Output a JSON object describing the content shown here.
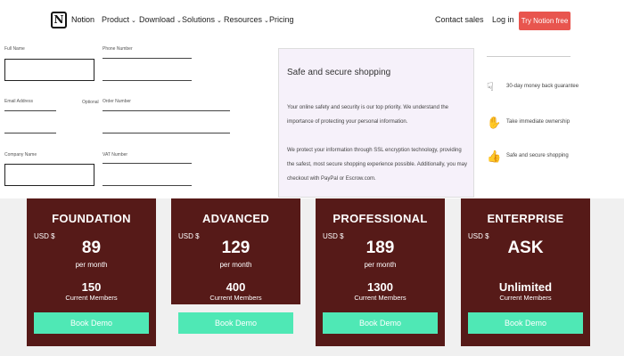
{
  "nav": {
    "logo_letter": "N",
    "brand": "Notion",
    "items": [
      {
        "label": "Product",
        "chevron": "⌄"
      },
      {
        "label": "Download",
        "chevron": "⌄"
      },
      {
        "label": "Solutions",
        "chevron": "⌄"
      },
      {
        "label": "Resources",
        "chevron": "⌄"
      },
      {
        "label": "Pricing",
        "chevron": ""
      }
    ],
    "contact_sales": "Contact sales",
    "login": "Log in",
    "cta": "Try Notion free",
    "cta_color": "#e8554e"
  },
  "form": {
    "full_name": "Full Name",
    "phone_number": "Phone Number",
    "email_address": "Email Address",
    "optional": "Optional",
    "order_number": "Order Number",
    "company_name": "Company Name",
    "vat_number": "VAT Number"
  },
  "secure": {
    "title": "Safe and secure shopping",
    "p1": "Your online safety and security is our top priority. We understand the importance of protecting your personal information.",
    "p2": "We protect your information through SSL encryption technology, providing the safest, most secure shopping experience possible. Additionally, you may checkout with PayPal or Escrow.com."
  },
  "features": [
    {
      "icon": "money-back-icon",
      "glyph": "☟",
      "label": "30-day money back guarantee"
    },
    {
      "icon": "ownership-icon",
      "glyph": "✋",
      "label": "Take immediate ownership"
    },
    {
      "icon": "thumbs-up-icon",
      "glyph": "👍",
      "label": "Safe and secure shopping"
    }
  ],
  "plans": [
    {
      "name": "FOUNDATION",
      "currency": "USD $",
      "price": "89",
      "period": "per month",
      "members": "150",
      "members_label": "Current Members",
      "button": "Book Demo"
    },
    {
      "name": "ADVANCED",
      "currency": "USD $",
      "price": "129",
      "period": "per month",
      "members": "400",
      "members_label": "Current Members",
      "button": "Book Demo"
    },
    {
      "name": "PROFESSIONAL",
      "currency": "USD $",
      "price": "189",
      "period": "per month",
      "members": "1300",
      "members_label": "Current Members",
      "button": "Book Demo"
    },
    {
      "name": "ENTERPRISE",
      "currency": "USD $",
      "price": "ASK",
      "period": "",
      "members": "Unlimited",
      "members_label": "Current Members",
      "button": "Book Demo"
    }
  ],
  "colors": {
    "plan_bg": "#561a18",
    "button_bg": "#4fe8b5",
    "secure_bg": "#f6f1fa"
  }
}
